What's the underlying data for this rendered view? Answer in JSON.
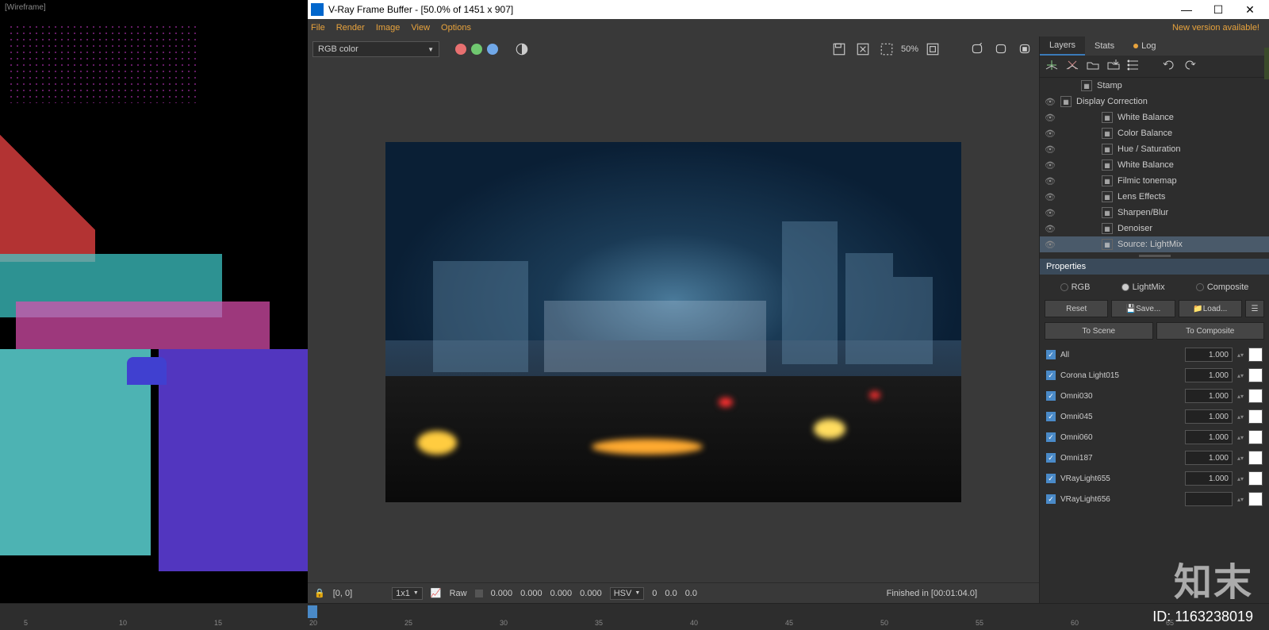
{
  "viewport": {
    "label": "[Wireframe]"
  },
  "window": {
    "title": "V-Ray Frame Buffer - [50.0% of 1451 x 907]"
  },
  "menu": {
    "file": "File",
    "render": "Render",
    "image": "Image",
    "view": "View",
    "options": "Options",
    "new_version": "New version available!"
  },
  "toolbar": {
    "channel": "RGB color",
    "dots": [
      "#e87070",
      "#70c870",
      "#70a8e8"
    ],
    "pct": "50%"
  },
  "statusbar": {
    "lock": "🔒",
    "coords": "[0, 0]",
    "grid": "1x1",
    "raw": "Raw",
    "vals": [
      "0.000",
      "0.000",
      "0.000",
      "0.000"
    ],
    "mode": "HSV",
    "hsv": [
      "0",
      "0.0",
      "0.0"
    ],
    "finished": "Finished in [00:01:04.0]"
  },
  "tabs": {
    "layers": "Layers",
    "stats": "Stats",
    "log": "Log"
  },
  "layers": [
    {
      "name": "Stamp",
      "indent": 1,
      "eye": false,
      "selected": false
    },
    {
      "name": "Display Correction",
      "indent": 0,
      "eye": true,
      "selected": false
    },
    {
      "name": "White Balance",
      "indent": 2,
      "eye": true,
      "selected": false
    },
    {
      "name": "Color Balance",
      "indent": 2,
      "eye": true,
      "selected": false
    },
    {
      "name": "Hue / Saturation",
      "indent": 2,
      "eye": true,
      "selected": false
    },
    {
      "name": "White Balance",
      "indent": 2,
      "eye": true,
      "selected": false
    },
    {
      "name": "Filmic tonemap",
      "indent": 2,
      "eye": true,
      "selected": false
    },
    {
      "name": "Lens Effects",
      "indent": 2,
      "eye": true,
      "selected": false
    },
    {
      "name": "Sharpen/Blur",
      "indent": 2,
      "eye": true,
      "selected": false
    },
    {
      "name": "Denoiser",
      "indent": 2,
      "eye": true,
      "selected": false
    },
    {
      "name": "Source: LightMix",
      "indent": 2,
      "eye": true,
      "selected": true
    }
  ],
  "properties": {
    "header": "Properties",
    "radios": {
      "rgb": "RGB",
      "lightmix": "LightMix",
      "composite": "Composite"
    },
    "buttons": {
      "reset": "Reset",
      "save": "💾Save...",
      "load": "📁Load...",
      "toscene": "To Scene",
      "tocomposite": "To Composite"
    },
    "mix": [
      {
        "name": "All",
        "val": "1.000"
      },
      {
        "name": "Corona Light015",
        "val": "1.000"
      },
      {
        "name": "Omni030",
        "val": "1.000"
      },
      {
        "name": "Omni045",
        "val": "1.000"
      },
      {
        "name": "Omni060",
        "val": "1.000"
      },
      {
        "name": "Omni187",
        "val": "1.000"
      },
      {
        "name": "VRayLight655",
        "val": "1.000"
      },
      {
        "name": "VRayLight656",
        "val": ""
      }
    ]
  },
  "timeline": {
    "ticks": [
      5,
      10,
      15,
      20,
      25,
      30,
      35,
      40,
      45,
      50,
      55,
      60,
      65
    ]
  },
  "overlay": {
    "watermark": "知末",
    "id": "ID: 1163238019"
  }
}
